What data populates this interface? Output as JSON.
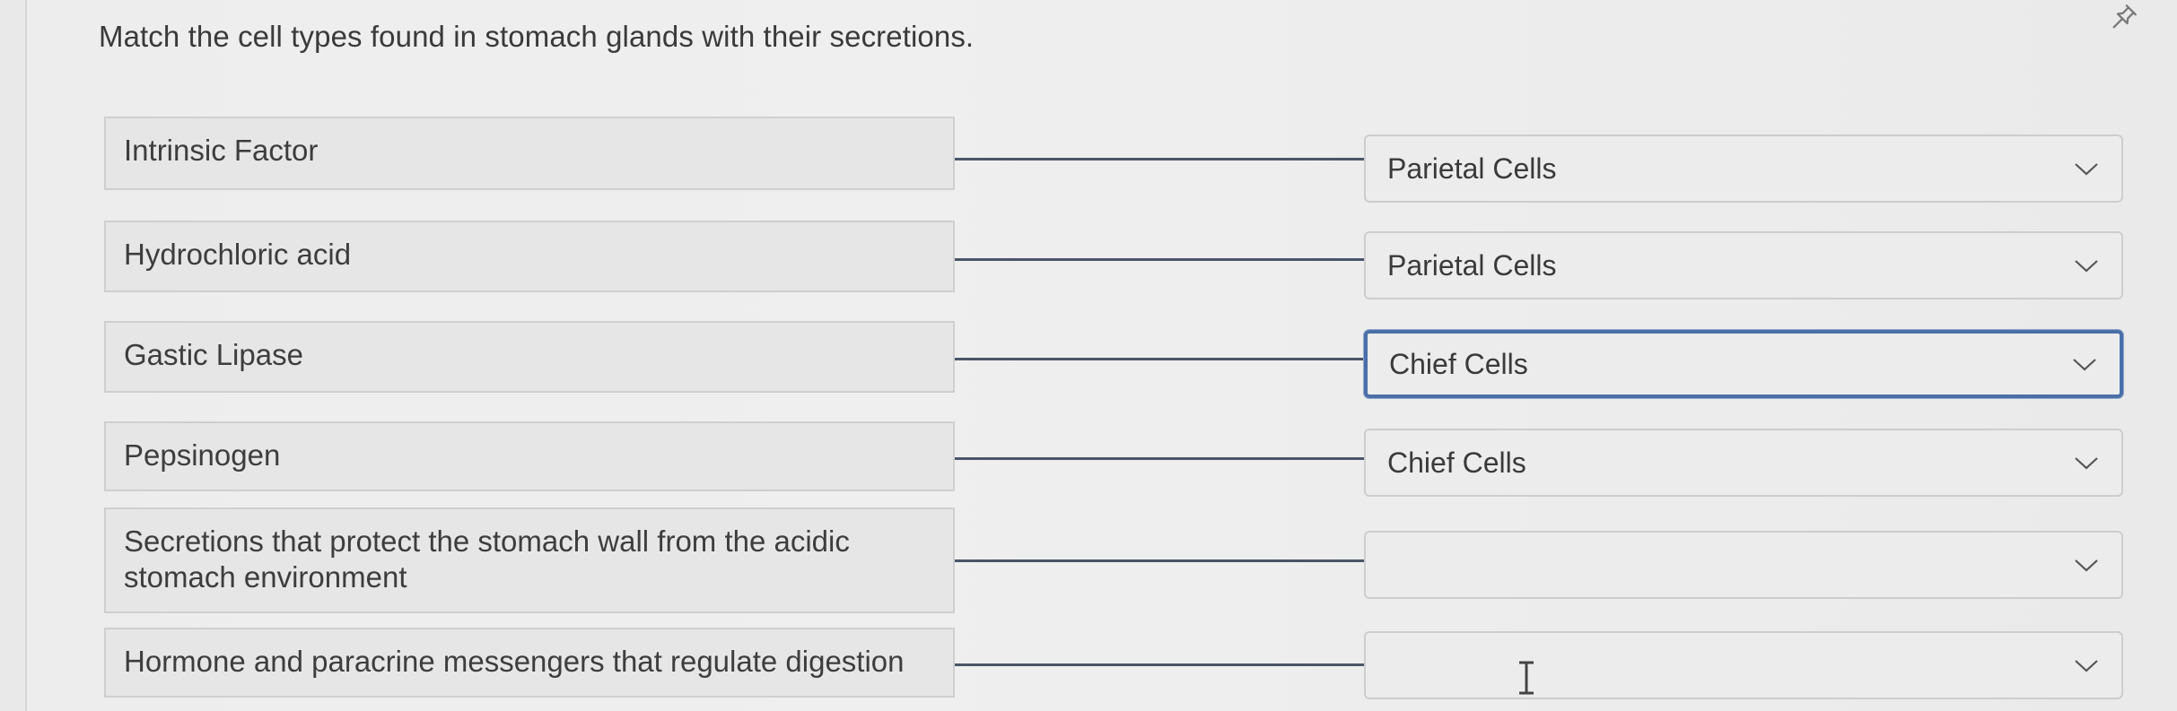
{
  "question": "Match the cell types found in stomach glands with their secretions.",
  "rows": [
    {
      "prompt": "Intrinsic Factor",
      "answer": "Parietal Cells"
    },
    {
      "prompt": "Hydrochloric acid",
      "answer": "Parietal Cells"
    },
    {
      "prompt": "Gastic Lipase",
      "answer": "Chief Cells"
    },
    {
      "prompt": "Pepsinogen",
      "answer": "Chief Cells"
    },
    {
      "prompt": "Secretions that protect the stomach wall from the acidic stomach environment",
      "answer": ""
    },
    {
      "prompt": "Hormone and paracrine messengers that regulate digestion",
      "answer": ""
    }
  ],
  "icons": {
    "pin": "pin-icon",
    "dropdown": "chevron-down-icon",
    "cursor": "text-cursor-icon"
  },
  "colors": {
    "focus_border": "#4a6fa8",
    "connector": "#4a5568"
  }
}
